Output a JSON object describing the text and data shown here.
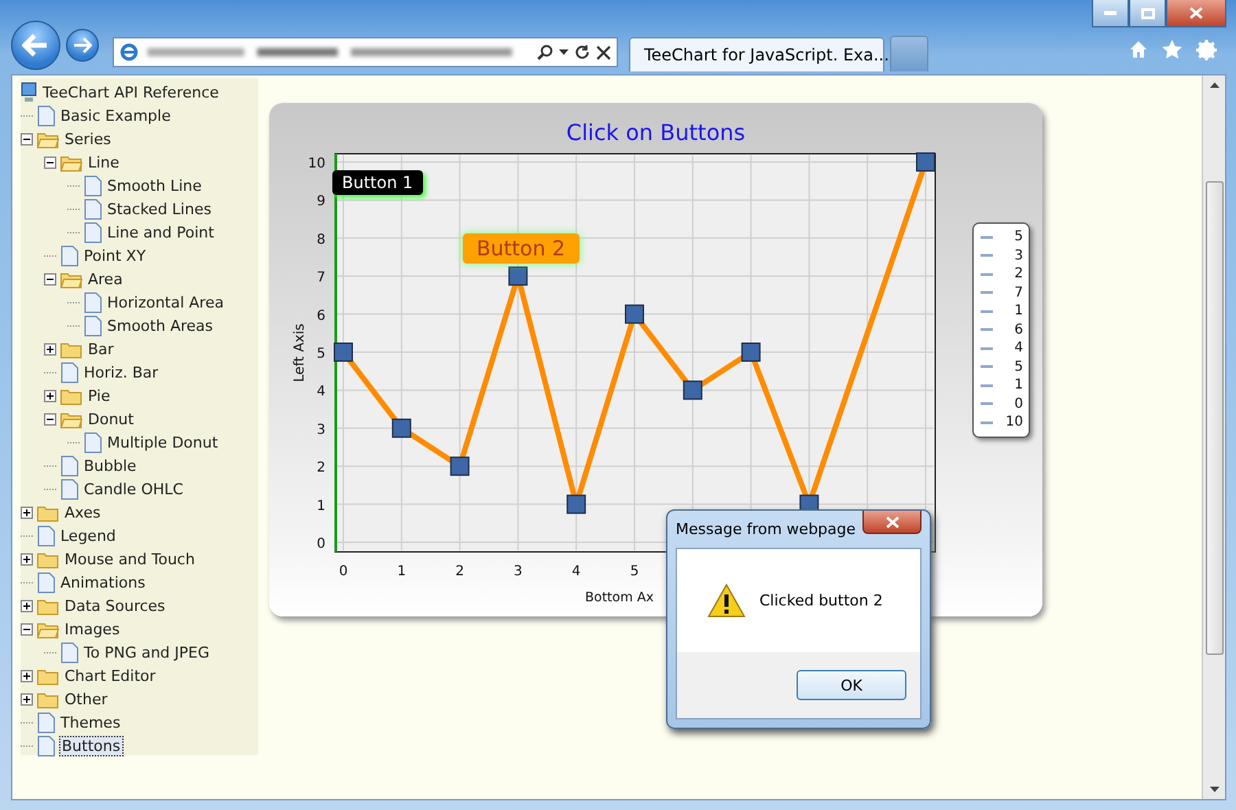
{
  "browser": {
    "tab_title": "TeeChart for JavaScript. Exa..."
  },
  "tree": {
    "label": "TeeChart API Reference",
    "children": [
      {
        "label": "Basic Example",
        "kind": "page",
        "selected": false
      },
      {
        "label": "Series",
        "kind": "folder",
        "expanded": true,
        "selected": false,
        "children": [
          {
            "label": "Line",
            "kind": "folder",
            "expanded": true,
            "selected": false,
            "children": [
              {
                "label": "Smooth Line",
                "kind": "page",
                "selected": false
              },
              {
                "label": "Stacked Lines",
                "kind": "page",
                "selected": false
              },
              {
                "label": "Line and Point",
                "kind": "page",
                "selected": false
              }
            ]
          },
          {
            "label": "Point XY",
            "kind": "page",
            "selected": false
          },
          {
            "label": "Area",
            "kind": "folder",
            "expanded": true,
            "selected": false,
            "children": [
              {
                "label": "Horizontal Area",
                "kind": "page",
                "selected": false
              },
              {
                "label": "Smooth Areas",
                "kind": "page",
                "selected": false
              }
            ]
          },
          {
            "label": "Bar",
            "kind": "folder",
            "expanded": false,
            "selected": false
          },
          {
            "label": "Horiz. Bar",
            "kind": "page",
            "selected": false
          },
          {
            "label": "Pie",
            "kind": "folder",
            "expanded": false,
            "selected": false
          },
          {
            "label": "Donut",
            "kind": "folder",
            "expanded": true,
            "selected": false,
            "children": [
              {
                "label": "Multiple Donut",
                "kind": "page",
                "selected": false
              }
            ]
          },
          {
            "label": "Bubble",
            "kind": "page",
            "selected": false
          },
          {
            "label": "Candle OHLC",
            "kind": "page",
            "selected": false
          }
        ]
      },
      {
        "label": "Axes",
        "kind": "folder",
        "expanded": false,
        "selected": false
      },
      {
        "label": "Legend",
        "kind": "page",
        "selected": false
      },
      {
        "label": "Mouse and Touch",
        "kind": "folder",
        "expanded": false,
        "selected": false
      },
      {
        "label": "Animations",
        "kind": "page",
        "selected": false
      },
      {
        "label": "Data Sources",
        "kind": "folder",
        "expanded": false,
        "selected": false
      },
      {
        "label": "Images",
        "kind": "folder",
        "expanded": true,
        "selected": false,
        "children": [
          {
            "label": "To PNG and JPEG",
            "kind": "page",
            "selected": false
          }
        ]
      },
      {
        "label": "Chart Editor",
        "kind": "folder",
        "expanded": false,
        "selected": false
      },
      {
        "label": "Other",
        "kind": "folder",
        "expanded": false,
        "selected": false
      },
      {
        "label": "Themes",
        "kind": "page",
        "selected": false
      },
      {
        "label": "Buttons",
        "kind": "page",
        "selected": true
      }
    ]
  },
  "chart": {
    "title": "Click on Buttons",
    "chart_data": {
      "type": "line",
      "grid": true,
      "xlabel": "Bottom Ax",
      "ylabel": "Left Axis",
      "x": [
        0,
        1,
        2,
        3,
        4,
        5,
        6,
        7,
        8,
        9,
        10
      ],
      "series": [
        {
          "color": "#ff8c00",
          "marker": "square",
          "values": [
            5,
            3,
            2,
            7,
            1,
            6,
            4,
            5,
            1,
            null,
            10
          ]
        }
      ],
      "xlim": [
        0,
        10
      ],
      "ylim": [
        0,
        10
      ],
      "xticks": [
        0,
        1,
        2,
        3,
        4,
        5
      ],
      "yticks": [
        0,
        1,
        2,
        3,
        4,
        5,
        6,
        7,
        8,
        9,
        10
      ]
    },
    "buttons": [
      {
        "label": "Button 1",
        "kind": "dark"
      },
      {
        "label": "Button 2",
        "kind": "orange"
      }
    ],
    "legend": [
      "5",
      "3",
      "2",
      "7",
      "1",
      "6",
      "4",
      "5",
      "1",
      "0",
      "10"
    ]
  },
  "dialog": {
    "title": "Message from webpage",
    "message": "Clicked button 2",
    "button": "OK"
  }
}
